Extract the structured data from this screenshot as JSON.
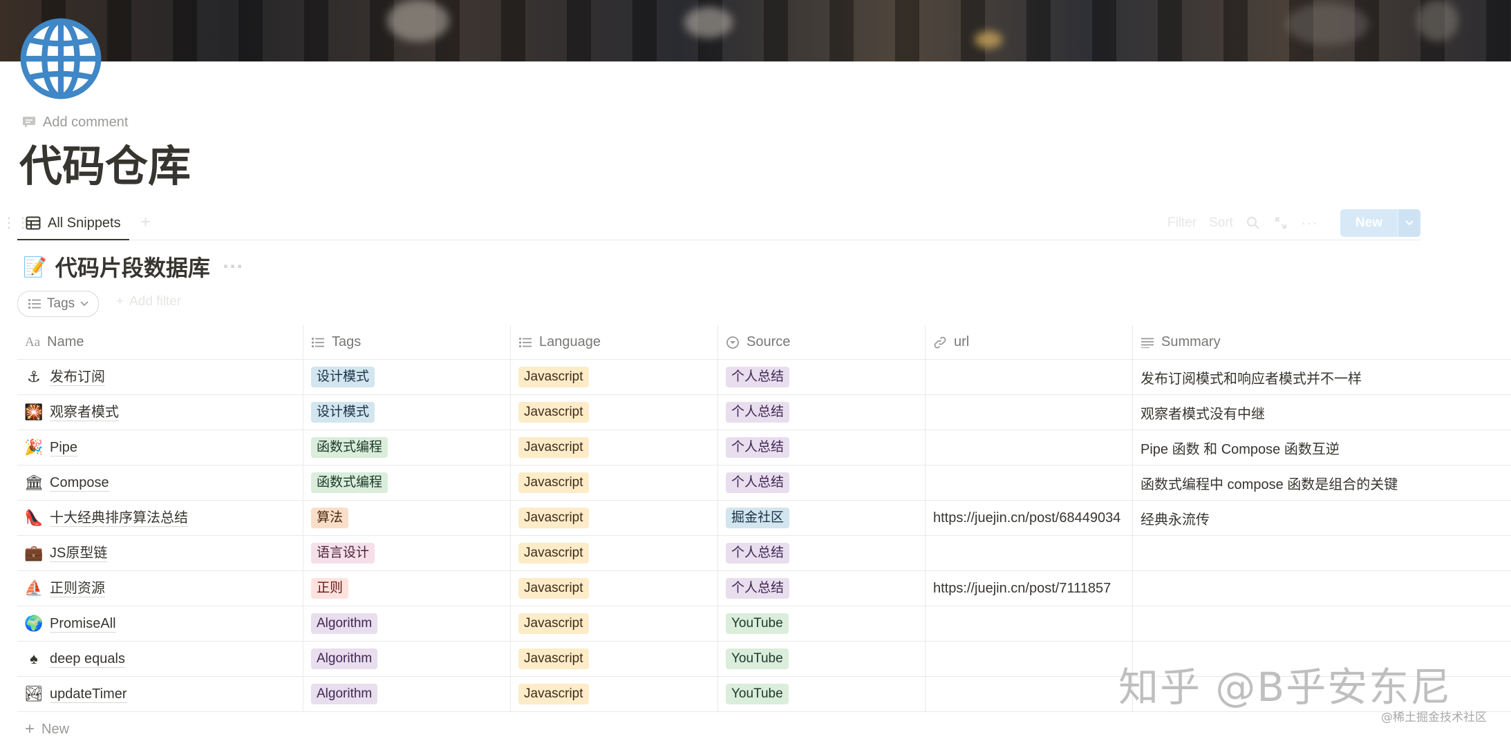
{
  "page": {
    "add_comment": "Add comment",
    "title": "代码仓库"
  },
  "views": {
    "active_tab": "All Snippets",
    "add_view": "+",
    "filter": "Filter",
    "sort": "Sort",
    "new_button": "New"
  },
  "database": {
    "emoji": "📝",
    "title": "代码片段数据库",
    "more": "···",
    "filter_chip": "Tags",
    "add_filter": "Add filter"
  },
  "table": {
    "columns": [
      {
        "label": "Name",
        "icon": "text-aa-icon"
      },
      {
        "label": "Tags",
        "icon": "list-icon"
      },
      {
        "label": "Language",
        "icon": "list-icon"
      },
      {
        "label": "Source",
        "icon": "select-icon"
      },
      {
        "label": "url",
        "icon": "link-icon"
      },
      {
        "label": "Summary",
        "icon": "lines-icon"
      }
    ],
    "rows": [
      {
        "emoji": "⚓",
        "name": "发布订阅",
        "tag": "设计模式",
        "language": "Javascript",
        "source": "个人总结",
        "url": "",
        "summary": "发布订阅模式和响应者模式并不一样"
      },
      {
        "emoji": "🎇",
        "name": "观察者模式",
        "tag": "设计模式",
        "language": "Javascript",
        "source": "个人总结",
        "url": "",
        "summary": "观察者模式没有中继"
      },
      {
        "emoji": "🎉",
        "name": "Pipe",
        "tag": "函数式编程",
        "language": "Javascript",
        "source": "个人总结",
        "url": "",
        "summary": "Pipe 函数 和 Compose 函数互逆"
      },
      {
        "emoji": "🏛",
        "name": "Compose",
        "tag": "函数式编程",
        "language": "Javascript",
        "source": "个人总结",
        "url": "",
        "summary": "函数式编程中 compose 函数是组合的关键"
      },
      {
        "emoji": "👠",
        "name": "十大经典排序算法总结",
        "tag": "算法",
        "language": "Javascript",
        "source": "掘金社区",
        "url": "https://juejin.cn/post/68449034",
        "summary": "经典永流传"
      },
      {
        "emoji": "💼",
        "name": "JS原型链",
        "tag": "语言设计",
        "language": "Javascript",
        "source": "个人总结",
        "url": "",
        "summary": ""
      },
      {
        "emoji": "⛵",
        "name": "正则资源",
        "tag": "正则",
        "language": "Javascript",
        "source": "个人总结",
        "url": "https://juejin.cn/post/7111857",
        "summary": ""
      },
      {
        "emoji": "🌍",
        "name": "PromiseAll",
        "tag": "Algorithm",
        "language": "Javascript",
        "source": "YouTube",
        "url": "",
        "summary": ""
      },
      {
        "emoji": "♠",
        "name": "deep equals",
        "tag": "Algorithm",
        "language": "Javascript",
        "source": "YouTube",
        "url": "",
        "summary": ""
      },
      {
        "emoji": "🏞",
        "name": "updateTimer",
        "tag": "Algorithm",
        "language": "Javascript",
        "source": "YouTube",
        "url": "",
        "summary": ""
      }
    ],
    "new_row": "New"
  },
  "tag_colors": {
    "设计模式": {
      "bg": "#d3e5ef",
      "fg": "#183347"
    },
    "函数式编程": {
      "bg": "#dbeddb",
      "fg": "#1c3829"
    },
    "算法": {
      "bg": "#fadec9",
      "fg": "#49290e"
    },
    "语言设计": {
      "bg": "#f5e0e9",
      "fg": "#4c2337"
    },
    "正则": {
      "bg": "#ffe2dd",
      "fg": "#5d1715"
    },
    "Algorithm": {
      "bg": "#e8deee",
      "fg": "#412454"
    },
    "Javascript": {
      "bg": "#fdecc8",
      "fg": "#402c1b"
    },
    "个人总结": {
      "bg": "#e8deee",
      "fg": "#412454"
    },
    "掘金社区": {
      "bg": "#d3e5ef",
      "fg": "#183347"
    },
    "YouTube": {
      "bg": "#dbeddb",
      "fg": "#1c3829"
    }
  },
  "watermark": {
    "main": "知乎 @B乎安东尼",
    "sub": "@稀土掘金技术社区"
  }
}
